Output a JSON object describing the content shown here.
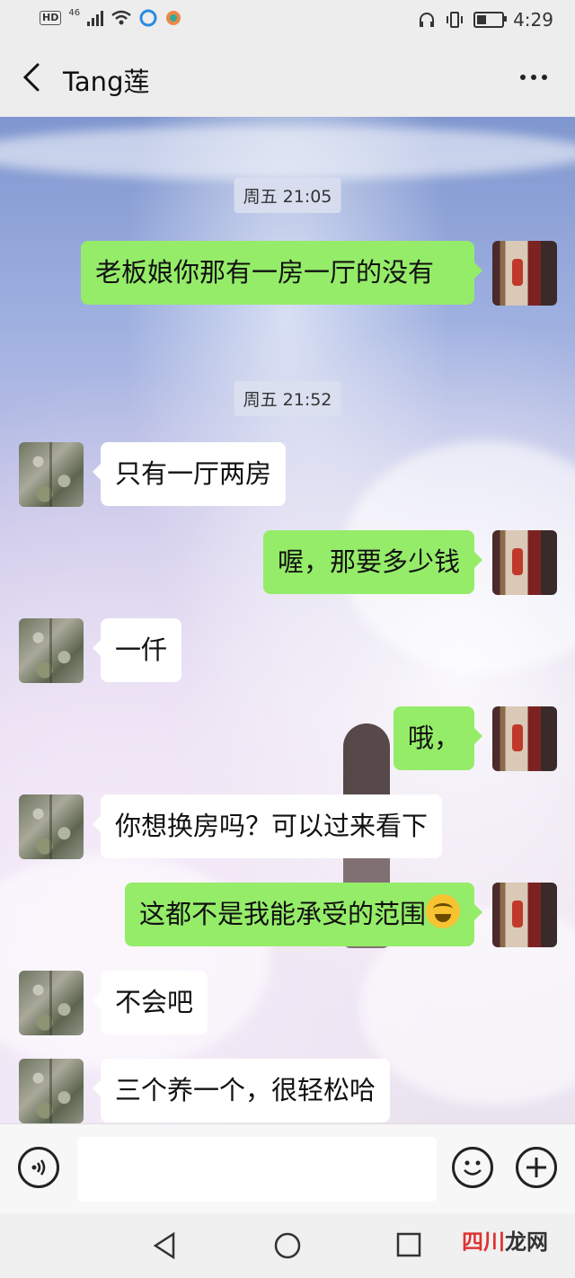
{
  "status_bar": {
    "network": "46",
    "time": "4:29"
  },
  "header": {
    "title": "Tang莲",
    "back_icon": "chevron-left-icon",
    "more_icon": "more-dots-icon"
  },
  "messages": [
    {
      "type": "time",
      "text": "周五 21:05"
    },
    {
      "type": "me",
      "text": "老板娘你那有一房一厅的没有"
    },
    {
      "type": "time",
      "text": "周五 21:52"
    },
    {
      "type": "other",
      "text": "只有一厅两房"
    },
    {
      "type": "me",
      "text": "喔，那要多少钱"
    },
    {
      "type": "other",
      "text": "一仟"
    },
    {
      "type": "me",
      "text": "哦，"
    },
    {
      "type": "other",
      "text": "你想换房吗？可以过来看下"
    },
    {
      "type": "me",
      "text": "这都不是我能承受的范围",
      "emoji": "crying-laughing-emoji"
    },
    {
      "type": "other",
      "text": "不会吧"
    },
    {
      "type": "other",
      "text": "三个养一个，很轻松哈"
    }
  ],
  "input_bar": {
    "voice_icon": "voice-icon",
    "emoji_icon": "emoji-icon",
    "plus_icon": "plus-icon",
    "placeholder": ""
  },
  "watermark": {
    "part1": "四川",
    "part2": "龙网"
  }
}
